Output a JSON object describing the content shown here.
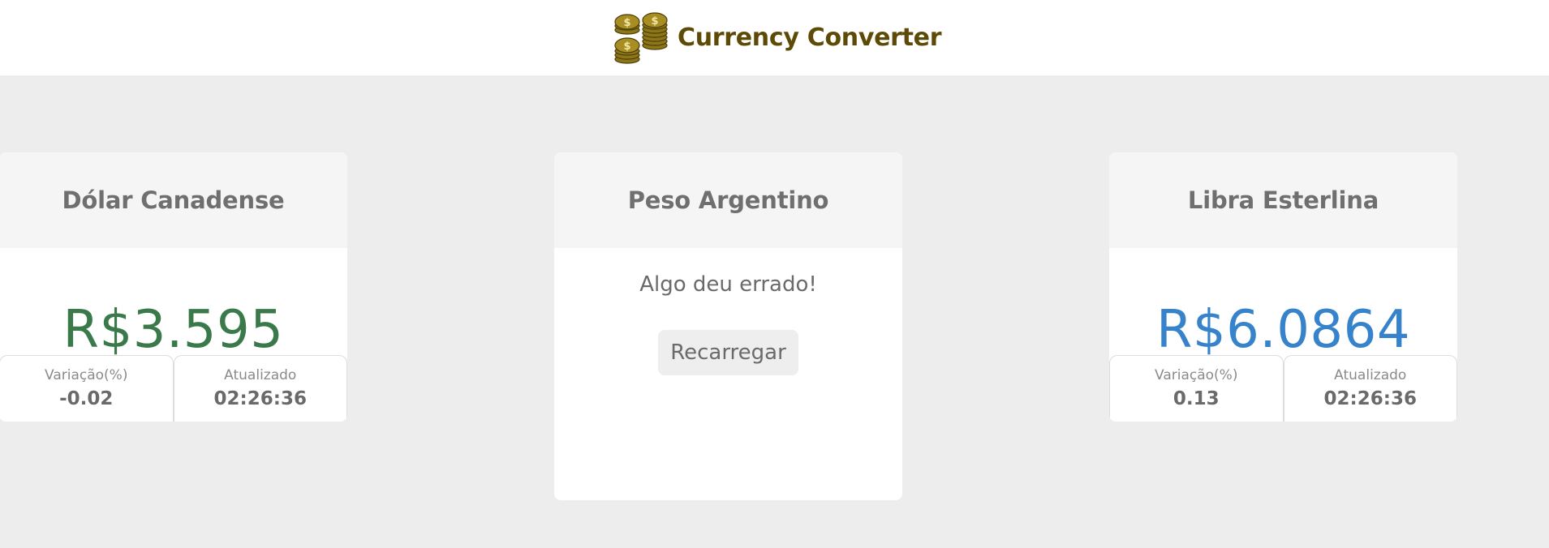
{
  "app": {
    "title": "Currency Converter",
    "logo_icon": "stacked-coins-dollar-icon"
  },
  "colors": {
    "brand": "#5c4a06",
    "price_negative": "#3a7a4a",
    "price_positive": "#3683cb",
    "background": "#ededed"
  },
  "cards": [
    {
      "title": "Dólar Canadense",
      "price": "R$3.595",
      "variation_label": "Variação(%)",
      "variation_value": "-0.02",
      "updated_label": "Atualizado",
      "updated_value": "02:26:36"
    },
    {
      "title": "Peso Argentino",
      "error_message": "Algo deu errado!",
      "reload_label": "Recarregar"
    },
    {
      "title": "Libra Esterlina",
      "price": "R$6.0864",
      "variation_label": "Variação(%)",
      "variation_value": "0.13",
      "updated_label": "Atualizado",
      "updated_value": "02:26:36"
    }
  ]
}
